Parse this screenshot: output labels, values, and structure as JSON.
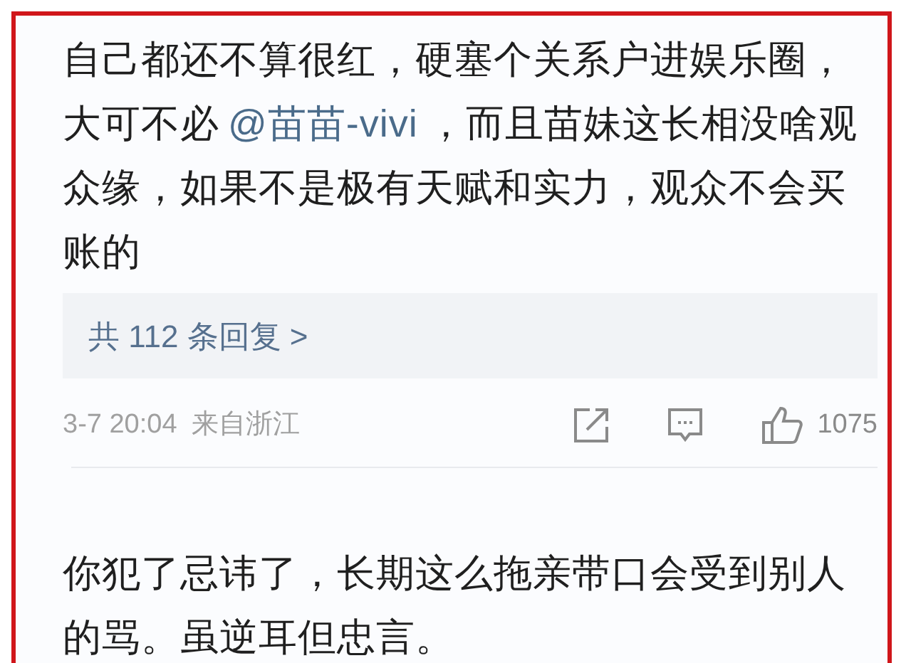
{
  "comments": [
    {
      "segments": [
        {
          "kind": "text",
          "text": "自己都还不算很红，硬塞个关系户进娱乐圈，大可不必"
        },
        {
          "kind": "mention",
          "text": "@苗苗-vivi"
        },
        {
          "kind": "text",
          "text": "，而且苗妹这长相没啥观众缘，如果不是极有天赋和实力，观众不会买账的"
        }
      ],
      "replies": "共 112 条回复 >",
      "time": "3-7 20:04",
      "location": "来自浙江",
      "likes": "1075"
    },
    {
      "segments": [
        {
          "kind": "text",
          "text": "你犯了忌讳了，长期这么拖亲带口会受到别人的骂。虽逆耳但忠言。"
        }
      ]
    }
  ]
}
